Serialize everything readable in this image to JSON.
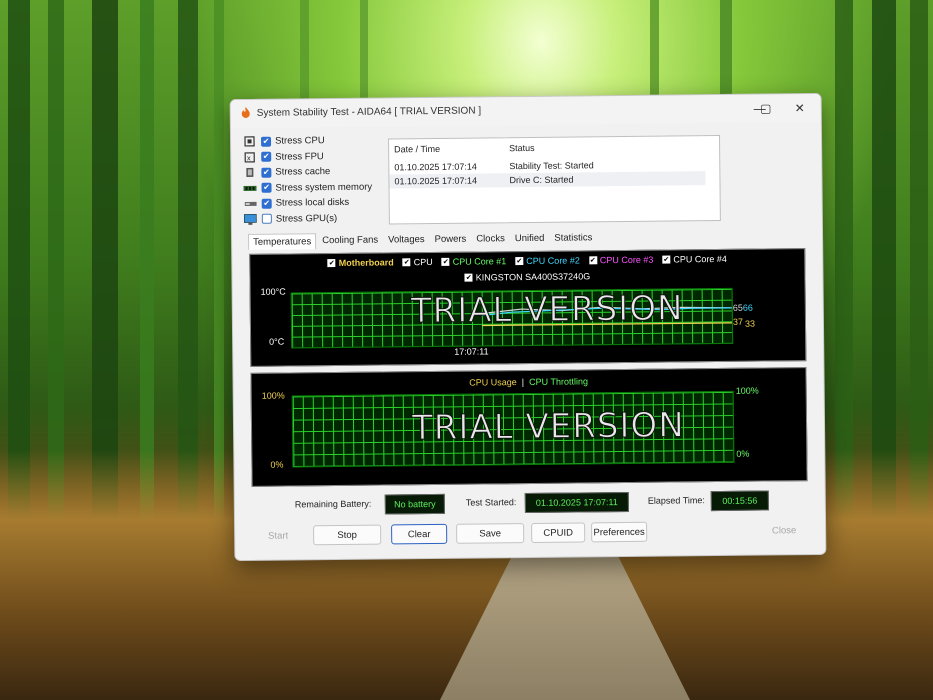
{
  "window": {
    "title": "System Stability Test - AIDA64  [ TRIAL VERSION ]",
    "app_icon": "flame-icon",
    "controls": {
      "minimize": "—",
      "maximize": "▢",
      "close": "✕"
    }
  },
  "stress_options": [
    {
      "label": "Stress CPU",
      "checked": true,
      "icon": "cpu-icon"
    },
    {
      "label": "Stress FPU",
      "checked": true,
      "icon": "fpu-icon"
    },
    {
      "label": "Stress cache",
      "checked": true,
      "icon": "cache-icon"
    },
    {
      "label": "Stress system memory",
      "checked": true,
      "icon": "memory-icon"
    },
    {
      "label": "Stress local disks",
      "checked": true,
      "icon": "disk-icon"
    },
    {
      "label": "Stress GPU(s)",
      "checked": false,
      "icon": "monitor-icon"
    }
  ],
  "log": {
    "col_datetime": "Date / Time",
    "col_status": "Status",
    "rows": [
      {
        "datetime": "01.10.2025 17:07:14",
        "status": "Stability Test: Started"
      },
      {
        "datetime": "01.10.2025 17:07:14",
        "status": "Drive C: Started"
      }
    ]
  },
  "tabs": [
    "Temperatures",
    "Cooling Fans",
    "Voltages",
    "Powers",
    "Clocks",
    "Unified",
    "Statistics"
  ],
  "active_tab": 0,
  "temperature_graph": {
    "legend_row1": [
      {
        "label": "Motherboard",
        "color": "#f0d050",
        "checked": true
      },
      {
        "label": "CPU",
        "color": "#ffffff",
        "checked": true
      },
      {
        "label": "CPU Core #1",
        "color": "#66ff66",
        "checked": true
      },
      {
        "label": "CPU Core #2",
        "color": "#40d8ff",
        "checked": true
      },
      {
        "label": "CPU Core #3",
        "color": "#ff55ff",
        "checked": true
      },
      {
        "label": "CPU Core #4",
        "color": "#ffffff",
        "checked": true
      }
    ],
    "legend_row2": [
      {
        "label": "KINGSTON SA400S37240G",
        "color": "#ffffff",
        "checked": true
      }
    ],
    "y_max_label": "100°C",
    "y_min_label": "0°C",
    "x_label": "17:07:11",
    "value_labels": {
      "core_a": "65",
      "core_b": "66",
      "motherboard": "37",
      "disk": "33"
    },
    "watermark": "TRIAL VERSION",
    "series_colors": {
      "cpu": "#d8d8d8",
      "core": "#40d8ff",
      "motherboard": "#f0d050"
    }
  },
  "usage_graph": {
    "legend_usage": "CPU Usage",
    "legend_sep": "|",
    "legend_throttle": "CPU Throttling",
    "usage_color": "#f0d050",
    "throttle_color": "#66ff66",
    "y_left_max": "100%",
    "y_left_min": "0%",
    "y_right_max": "100%",
    "y_right_min": "0%",
    "watermark": "TRIAL VERSION"
  },
  "status_bar": {
    "battery_label": "Remaining Battery:",
    "battery_value": "No battery",
    "started_label": "Test Started:",
    "started_value": "01.10.2025 17:07:11",
    "elapsed_label": "Elapsed Time:",
    "elapsed_value": "00:15:56"
  },
  "buttons": {
    "start": "Start",
    "stop": "Stop",
    "clear": "Clear",
    "save": "Save",
    "cpuid": "CPUID",
    "preferences": "Preferences",
    "close": "Close"
  }
}
